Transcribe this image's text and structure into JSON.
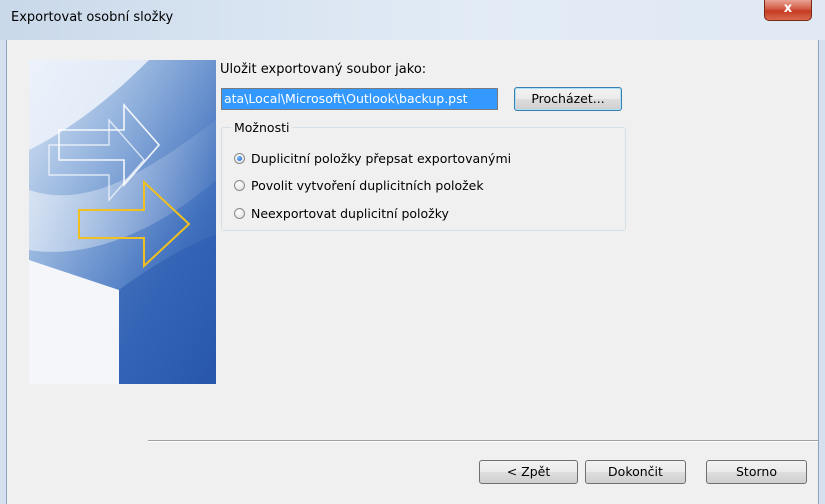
{
  "window": {
    "title": "Exportovat osobní složky",
    "close_glyph": "x"
  },
  "form": {
    "save_as_label": "Uložit exportovaný soubor jako:",
    "file_path_value": "ata\\Local\\Microsoft\\Outlook\\backup.pst",
    "browse_label": "Procházet..."
  },
  "options": {
    "legend": "Možnosti",
    "items": [
      {
        "label": "Duplicitní položky přepsat exportovanými",
        "checked": true
      },
      {
        "label": "Povolit vytvoření duplicitních položek",
        "checked": false
      },
      {
        "label": "Neexportovat duplicitní položky",
        "checked": false
      }
    ]
  },
  "footer": {
    "back_label": "< Zpět",
    "finish_label": "Dokončit",
    "cancel_label": "Storno"
  },
  "colors": {
    "selection": "#3399ff",
    "dialog_bg": "#f0f0f0",
    "close_red": "#c43b21",
    "banner_blue": "#2a5aa8"
  }
}
